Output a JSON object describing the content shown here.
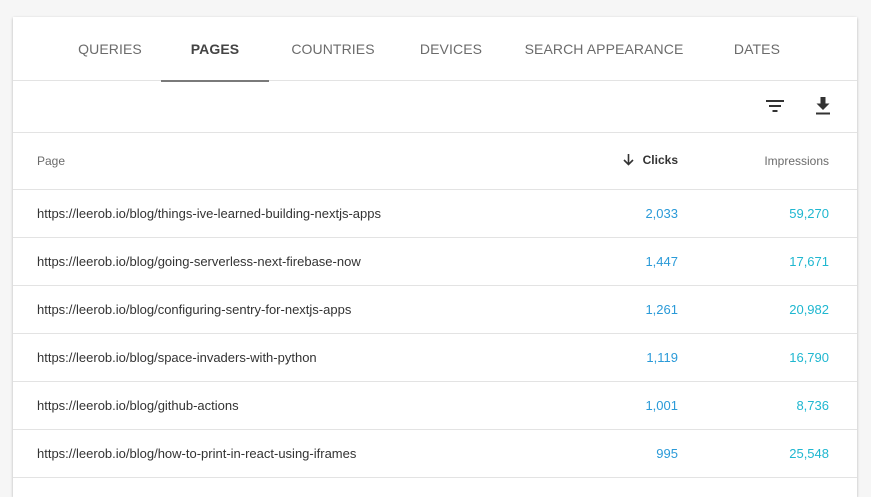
{
  "tabs": [
    {
      "label": "QUERIES",
      "active": false
    },
    {
      "label": "PAGES",
      "active": true
    },
    {
      "label": "COUNTRIES",
      "active": false
    },
    {
      "label": "DEVICES",
      "active": false
    },
    {
      "label": "SEARCH APPEARANCE",
      "active": false
    },
    {
      "label": "DATES",
      "active": false
    }
  ],
  "toolbar": {
    "filter_icon": "filter-icon",
    "download_icon": "download-icon"
  },
  "table": {
    "headers": {
      "page": "Page",
      "clicks": "Clicks",
      "impressions": "Impressions"
    },
    "sort": {
      "column": "clicks",
      "direction": "descending",
      "icon": "arrow-down-icon"
    },
    "rows": [
      {
        "page": "https://leerob.io/blog/things-ive-learned-building-nextjs-apps",
        "clicks": "2,033",
        "impressions": "59,270"
      },
      {
        "page": "https://leerob.io/blog/going-serverless-next-firebase-now",
        "clicks": "1,447",
        "impressions": "17,671"
      },
      {
        "page": "https://leerob.io/blog/configuring-sentry-for-nextjs-apps",
        "clicks": "1,261",
        "impressions": "20,982"
      },
      {
        "page": "https://leerob.io/blog/space-invaders-with-python",
        "clicks": "1,119",
        "impressions": "16,790"
      },
      {
        "page": "https://leerob.io/blog/github-actions",
        "clicks": "1,001",
        "impressions": "8,736"
      },
      {
        "page": "https://leerob.io/blog/how-to-print-in-react-using-iframes",
        "clicks": "995",
        "impressions": "25,548"
      }
    ]
  },
  "colors": {
    "clicks": "#2a9ad8",
    "impressions": "#1fb7d0",
    "active_tab_underline": "#7a7a7a"
  }
}
